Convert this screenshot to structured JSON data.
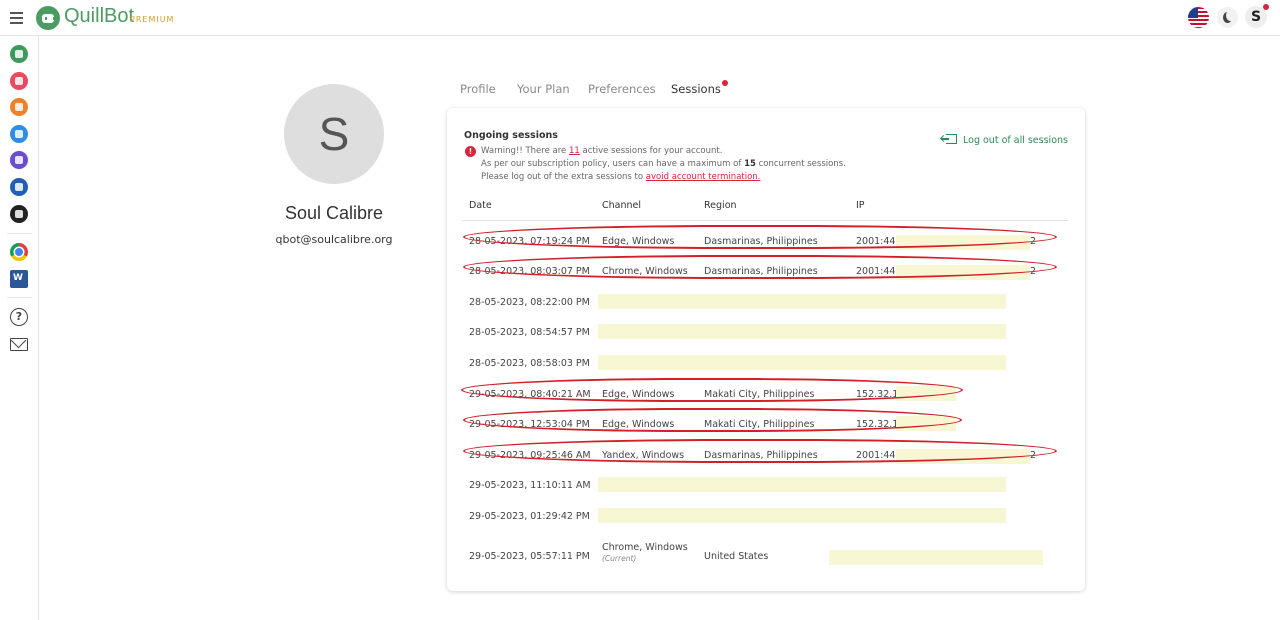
{
  "topbar": {
    "brand": "QuillBot",
    "tier": "PREMIUM",
    "user_initial": "S"
  },
  "sidebar": {
    "icons": [
      {
        "name": "paraphraser-icon",
        "color": "#3d9a5c"
      },
      {
        "name": "grammar-checker-icon",
        "color": "#e84a5f"
      },
      {
        "name": "ai-detector-icon",
        "color": "#f0812a"
      },
      {
        "name": "co-writer-icon",
        "color": "#2f8de4"
      },
      {
        "name": "summarizer-icon",
        "color": "#6a4ccf"
      },
      {
        "name": "citation-generator-icon",
        "color": "#1f5fb8"
      },
      {
        "name": "translator-icon",
        "color": "#222222"
      }
    ]
  },
  "profile": {
    "initial": "S",
    "name": "Soul Calibre",
    "email": "qbot@soulcalibre.org"
  },
  "tabs": [
    {
      "label": "Profile"
    },
    {
      "label": "Your Plan"
    },
    {
      "label": "Preferences"
    },
    {
      "label": "Sessions"
    }
  ],
  "sessions": {
    "title": "Ongoing sessions",
    "warning_prefix": "Warning!! There are ",
    "warning_count": "11",
    "warning_suffix": " active sessions for your account.",
    "policy_prefix": "As per our subscription policy, users can have a maximum of ",
    "policy_max": "15",
    "policy_suffix": " concurrent sessions.",
    "logout_prefix": "Please log out of the extra sessions to ",
    "logout_link": "avoid account termination.",
    "logout_all": "Log out of all sessions",
    "columns": [
      "Date",
      "Channel",
      "Region",
      "IP"
    ],
    "rows": [
      {
        "date": "28-05-2023, 07:19:24 PM",
        "channel": "Edge, Windows",
        "region": "Dasmarinas, Philippines",
        "ip": "2001:445",
        "ip_end": "2"
      },
      {
        "date": "28-05-2023, 08:03:07 PM",
        "channel": "Chrome, Windows",
        "region": "Dasmarinas, Philippines",
        "ip": "2001:445",
        "ip_end": "2"
      },
      {
        "date": "28-05-2023, 08:22:00 PM",
        "channel": "",
        "region": "",
        "ip": "",
        "ip_end": ""
      },
      {
        "date": "28-05-2023, 08:54:57 PM",
        "channel": "",
        "region": "",
        "ip": "",
        "ip_end": ""
      },
      {
        "date": "28-05-2023, 08:58:03 PM",
        "channel": "",
        "region": "",
        "ip": "",
        "ip_end": ""
      },
      {
        "date": "29-05-2023, 08:40:21 AM",
        "channel": "Edge, Windows",
        "region": "Makati City, Philippines",
        "ip": "152.32.10",
        "ip_end": ""
      },
      {
        "date": "29-05-2023, 12:53:04 PM",
        "channel": "Edge, Windows",
        "region": "Makati City, Philippines",
        "ip": "152.32.10",
        "ip_end": ""
      },
      {
        "date": "29-05-2023, 09:25:46 AM",
        "channel": "Yandex, Windows",
        "region": "Dasmarinas, Philippines",
        "ip": "2001:445",
        "ip_end": "2"
      },
      {
        "date": "29-05-2023, 11:10:11 AM",
        "channel": "",
        "region": "",
        "ip": "",
        "ip_end": ""
      },
      {
        "date": "29-05-2023, 01:29:42 PM",
        "channel": "",
        "region": "",
        "ip": "",
        "ip_end": ""
      },
      {
        "date": "29-05-2023, 05:57:11 PM",
        "channel": "Chrome, Windows",
        "channel_note": "(Current)",
        "region": "United States",
        "ip": "",
        "ip_end": ""
      }
    ]
  }
}
